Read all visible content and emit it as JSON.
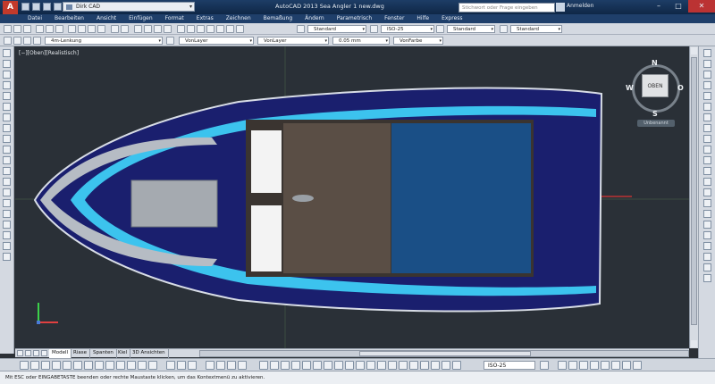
{
  "app": {
    "workspace": "Dirk CAD",
    "title": "AutoCAD 2013    Sea Angler 1 new.dwg",
    "search_placeholder": "Stichwort oder Frage eingeben",
    "login_label": "Anmelden",
    "logo": "A"
  },
  "menu": [
    "Datei",
    "Bearbeiten",
    "Ansicht",
    "Einfügen",
    "Format",
    "Extras",
    "Zeichnen",
    "Bemaßung",
    "Ändern",
    "Parametrisch",
    "Fenster",
    "Hilfe",
    "Express"
  ],
  "toolbar1": {
    "textstyle": "Standard",
    "dimstyle": "ISO-25",
    "tablestyle": "Standard",
    "multileaderstyle": "Standard"
  },
  "toolbar2": {
    "layer": "4m-Lenkung",
    "color": "VonLayer",
    "linetype": "VonLayer",
    "lineweight": "0.05 mm",
    "plotstyle": "VonFarbe"
  },
  "viewport": {
    "label": "[−][Oben][Realistisch]",
    "viewcube_top": "OBEN",
    "compass": {
      "n": "N",
      "s": "S",
      "e": "O",
      "w": "W"
    },
    "ucs_label": "Unbenannt"
  },
  "layout_tabs": [
    "Modell",
    "Riase",
    "Spanten",
    "Kiel",
    "3D Ansichten"
  ],
  "statusbar": {
    "annotation_scale": "ISO-25"
  },
  "command_line": "Mit ESC oder EINGABETASTE beenden oder rechte Maustaste klicken, um das Kontextmenü zu aktivieren."
}
